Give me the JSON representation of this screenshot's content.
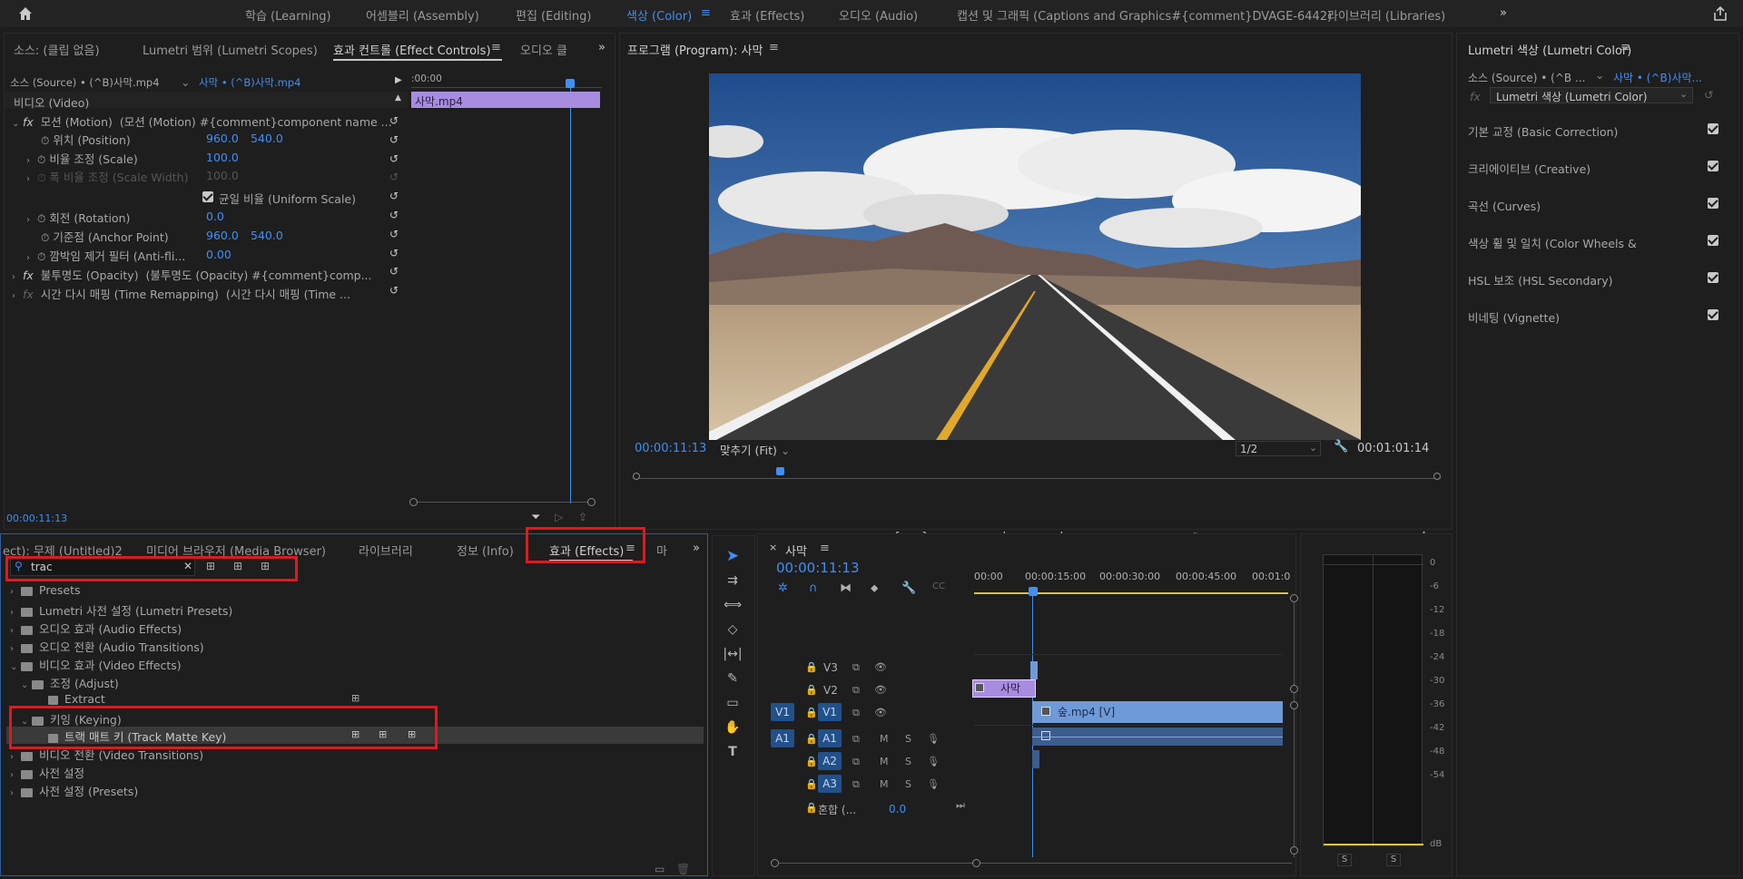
{
  "workspaces": [
    "학습 (Learning)",
    "어셈블리 (Assembly)",
    "편집 (Editing)",
    "색상 (Color)",
    "효과 (Effects)",
    "오디오 (Audio)",
    "캡션 및 그래픽 (Captions and Graphics#{comment}DVAGE-6442)",
    "라이브러리 (Libraries)"
  ],
  "active_workspace": "색상 (Color)",
  "source_panel": {
    "tabs": [
      "소스: (클립 없음)",
      "Lumetri 범위 (Lumetri Scopes)",
      "효과 컨트롤 (Effect Controls)",
      "오디오 클"
    ],
    "source_label": "소스 (Source) • (^B)사막.mp4",
    "seq_label": "사막 • (^B)사막.mp4",
    "video_header": "비디오 (Video)",
    "time_start": ":00:00",
    "clip_name": "사막.mp4",
    "timecode": "00:00:11:13",
    "rows": [
      {
        "label": "모션 (Motion)",
        "extra": "(모션 (Motion)   #{comment}component name ...",
        "fx": true
      },
      {
        "label": "위치 (Position)",
        "v1": "960.0",
        "v2": "540.0"
      },
      {
        "label": "비율 조정 (Scale)",
        "v1": "100.0"
      },
      {
        "label": "폭 비율 조정 (Scale Width)",
        "v1": "100.0",
        "dim": true
      },
      {
        "label": "균일 비율 (Uniform Scale)"
      },
      {
        "label": "회전 (Rotation)",
        "v1": "0.0"
      },
      {
        "label": "기준점 (Anchor Point)",
        "v1": "960.0",
        "v2": "540.0"
      },
      {
        "label": "깜박임 제거 필터 (Anti-fli...",
        "v1": "0.00"
      },
      {
        "label": "불투명도 (Opacity)",
        "extra": "(불투명도 (Opacity)  #{comment}comp...",
        "fx": true
      },
      {
        "label": "시간 다시 매핑 (Time Remapping)",
        "extra": "(시간 다시 매핑 (Time ...",
        "fx": true
      }
    ]
  },
  "program": {
    "title": "프로그램 (Program): 사막",
    "timecode": "00:00:11:13",
    "fit": "맞추기 (Fit)",
    "resolution": "1/2",
    "duration": "00:01:01:14"
  },
  "lumetri": {
    "title": "Lumetri 색상 (Lumetri Color)",
    "source": "소스 (Source) • (^B ...",
    "seq": "사막 • (^B)사막...",
    "effect": "Lumetri 색상 (Lumetri Color)",
    "sections": [
      "기본 교정 (Basic Correction)",
      "크리에이티브 (Creative)",
      "곡선 (Curves)",
      "색상 휠 및 일치 (Color Wheels &",
      "HSL 보조 (HSL Secondary)",
      "비네팅 (Vignette)"
    ]
  },
  "effects_panel": {
    "tabs": [
      "ect): 무제 (Untitled)2",
      "미디어 브라우저 (Media Browser)",
      "라이브러리",
      "정보 (Info)",
      "효과 (Effects)",
      "마"
    ],
    "search_value": "trac",
    "tree": [
      {
        "label": "Presets",
        "depth": 0,
        "kind": "bin"
      },
      {
        "label": "Lumetri 사전 설정 (Lumetri Presets)",
        "depth": 0,
        "kind": "bin"
      },
      {
        "label": "오디오 효과 (Audio Effects)",
        "depth": 0,
        "kind": "bin"
      },
      {
        "label": "오디오 전환 (Audio Transitions)",
        "depth": 0,
        "kind": "bin"
      },
      {
        "label": "비디오 효과 (Video Effects)",
        "depth": 0,
        "kind": "bin",
        "open": true
      },
      {
        "label": "조정 (Adjust)",
        "depth": 1,
        "kind": "folder",
        "open": true
      },
      {
        "label": "Extract",
        "depth": 2,
        "kind": "fx"
      },
      {
        "label": "키잉 (Keying)",
        "depth": 1,
        "kind": "folder",
        "open": true
      },
      {
        "label": "트랙 매트 키 (Track Matte Key)",
        "depth": 2,
        "kind": "fx",
        "selected": true
      },
      {
        "label": "비디오 전환 (Video Transitions)",
        "depth": 0,
        "kind": "bin"
      },
      {
        "label": "사전 설정",
        "depth": 0,
        "kind": "bin"
      },
      {
        "label": "사전 설정 (Presets)",
        "depth": 0,
        "kind": "bin"
      }
    ]
  },
  "timeline": {
    "title": "사막",
    "timecode": "00:00:11:13",
    "ruler": [
      "00:00",
      "00:00:15:00",
      "00:00:30:00",
      "00:00:45:00",
      "00:01:0"
    ],
    "tracks": [
      "V3",
      "V2",
      "V1",
      "A1",
      "A2",
      "A3"
    ],
    "source_v": "V1",
    "source_a": "A1",
    "mix_label": "혼합 (...",
    "mix_value": "0.0",
    "clip_v2": "사막",
    "clip_v1": "숲.mp4 [V]",
    "track_m": "M",
    "track_s": "S"
  },
  "meter": {
    "labels": [
      "0",
      "-6",
      "-12",
      "-18",
      "-24",
      "-30",
      "-36",
      "-42",
      "-48",
      "-54",
      "dB"
    ],
    "solo": [
      "S",
      "S"
    ]
  },
  "colors": {
    "accent": "#3f8ff5",
    "highlight": "#e0191f",
    "clip_purple": "#a78ce0",
    "clip_blue": "#6f9ad8"
  }
}
